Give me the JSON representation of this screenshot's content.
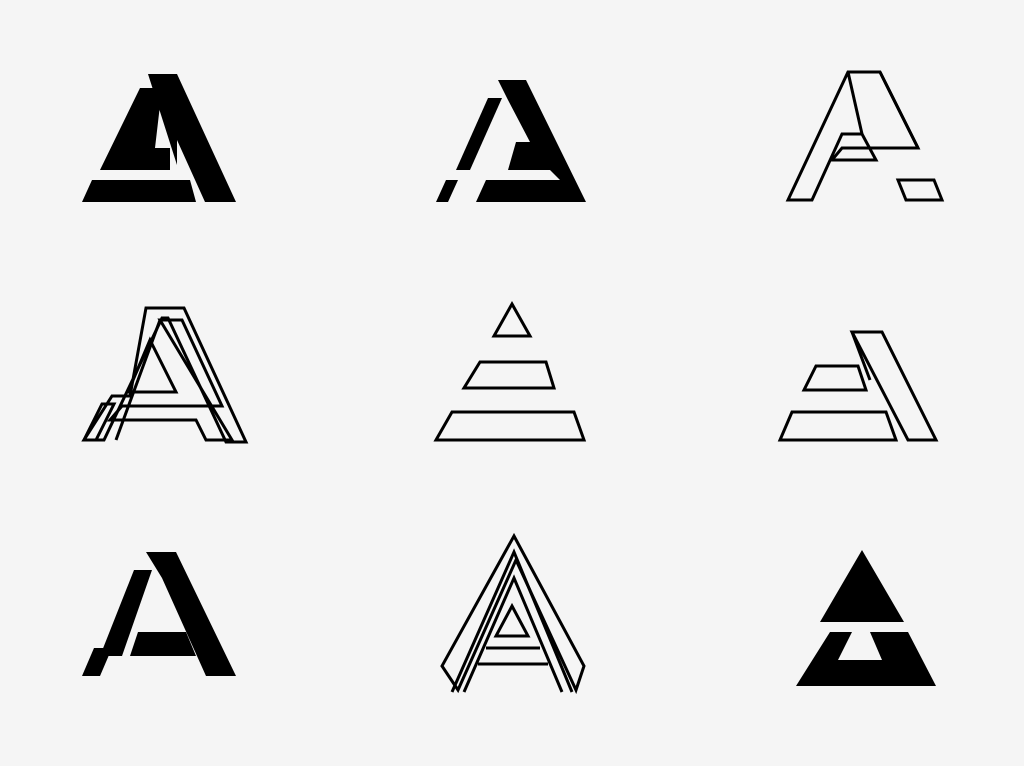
{
  "sheet": {
    "background": "#f5f5f5",
    "ink": "#000000",
    "grid": {
      "rows": 3,
      "columns": 3
    },
    "logos": [
      {
        "name": "logo-a-solid-stripe",
        "style": "solid"
      },
      {
        "name": "logo-a-solid-split",
        "style": "solid"
      },
      {
        "name": "logo-a-outline-cut",
        "style": "outline"
      },
      {
        "name": "logo-a-outline-layered",
        "style": "outline"
      },
      {
        "name": "logo-pyramid-outline-stripes",
        "style": "outline"
      },
      {
        "name": "logo-a-outline-offset",
        "style": "outline"
      },
      {
        "name": "logo-a-solid-notched",
        "style": "solid"
      },
      {
        "name": "logo-a-outline-inline",
        "style": "outline"
      },
      {
        "name": "logo-triangle-solid-cutout",
        "style": "solid"
      }
    ]
  }
}
